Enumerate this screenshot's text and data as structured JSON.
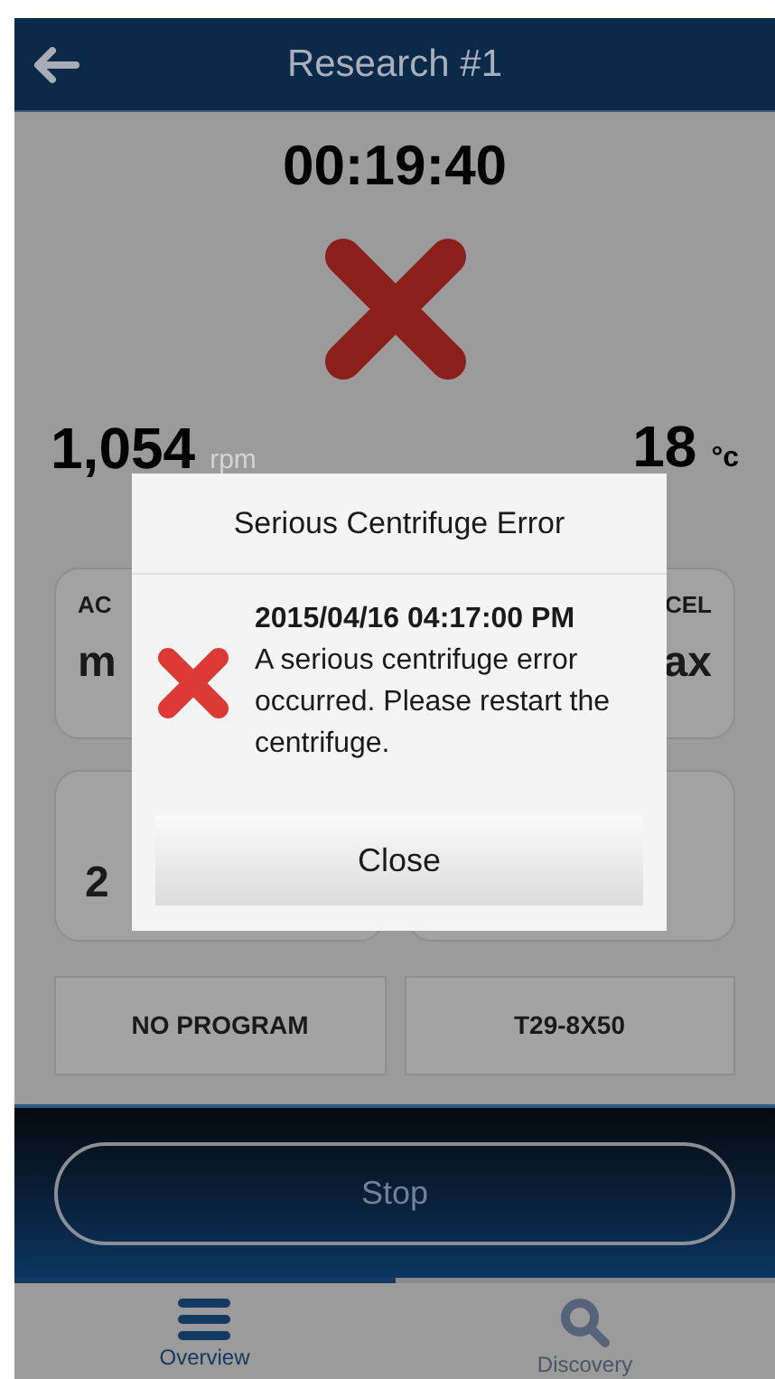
{
  "header": {
    "title": "Research #1"
  },
  "timer": "00:19:40",
  "status": {
    "kind": "error"
  },
  "speed": {
    "value": "1,054",
    "unit": "rpm"
  },
  "temperature": {
    "value": "18",
    "unit": "°c"
  },
  "settings": [
    {
      "label": "AC",
      "value": "m"
    },
    {
      "label": "CEL",
      "value": "ax"
    }
  ],
  "setpoints": [
    {
      "value": "2"
    }
  ],
  "program_buttons": [
    "NO PROGRAM",
    "T29-8X50"
  ],
  "stop_button": {
    "label": "Stop",
    "disabled": true
  },
  "tabs": [
    {
      "label": "Overview",
      "selected": true,
      "kind": "menu"
    },
    {
      "label": "Discovery",
      "selected": false,
      "kind": "search"
    }
  ],
  "dialog": {
    "title": "Serious Centrifuge Error",
    "timestamp": "2015/04/16 04:17:00 PM",
    "message": "A serious centrifuge error occurred. Please restart the centrifuge.",
    "button": "Close"
  }
}
